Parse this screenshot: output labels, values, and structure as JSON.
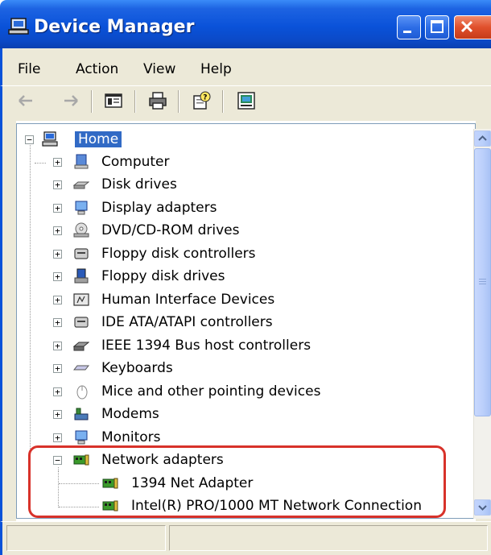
{
  "window": {
    "title": "Device Manager"
  },
  "menu": [
    {
      "label": "File"
    },
    {
      "label": "Action"
    },
    {
      "label": "View"
    },
    {
      "label": "Help"
    }
  ],
  "toolbar": [
    {
      "icon": "back-arrow-icon"
    },
    {
      "icon": "forward-arrow-icon"
    },
    {
      "icon": "show-hide-console-tree-icon"
    },
    {
      "icon": "print-icon"
    },
    {
      "icon": "help-icon"
    },
    {
      "icon": "properties-icon"
    }
  ],
  "tree": {
    "root": {
      "label": "Home",
      "expander": "−",
      "icon": "computer-icon"
    },
    "items": [
      {
        "label": "Computer",
        "expander": "+",
        "icon": "computer-icon"
      },
      {
        "label": "Disk drives",
        "expander": "+",
        "icon": "disk-drive-icon"
      },
      {
        "label": "Display adapters",
        "expander": "+",
        "icon": "display-adapter-icon"
      },
      {
        "label": "DVD/CD-ROM drives",
        "expander": "+",
        "icon": "cdrom-icon"
      },
      {
        "label": "Floppy disk controllers",
        "expander": "+",
        "icon": "controller-icon"
      },
      {
        "label": "Floppy disk drives",
        "expander": "+",
        "icon": "floppy-icon"
      },
      {
        "label": "Human Interface Devices",
        "expander": "+",
        "icon": "hid-icon"
      },
      {
        "label": "IDE ATA/ATAPI controllers",
        "expander": "+",
        "icon": "controller-icon"
      },
      {
        "label": "IEEE 1394 Bus host controllers",
        "expander": "+",
        "icon": "firewire-icon"
      },
      {
        "label": "Keyboards",
        "expander": "+",
        "icon": "keyboard-icon"
      },
      {
        "label": "Mice and other pointing devices",
        "expander": "+",
        "icon": "mouse-icon"
      },
      {
        "label": "Modems",
        "expander": "+",
        "icon": "modem-icon"
      },
      {
        "label": "Monitors",
        "expander": "+",
        "icon": "monitor-icon"
      },
      {
        "label": "Network adapters",
        "expander": "−",
        "icon": "network-card-icon",
        "children": [
          {
            "label": "1394 Net Adapter",
            "icon": "network-card-icon"
          },
          {
            "label": "Intel(R) PRO/1000 MT Network Connection",
            "icon": "network-card-icon"
          }
        ]
      }
    ]
  },
  "colors": {
    "title_bar": "#0a52d9",
    "selection": "#316ac5",
    "annotation_ring": "#d8322a",
    "chrome": "#ece9d8"
  }
}
